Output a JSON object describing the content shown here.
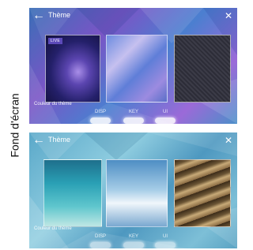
{
  "side_label": "Fond d'écran",
  "screens": [
    {
      "title": "Thème",
      "live_badge": "LIVE",
      "theme_color_label": "Couleur du thème",
      "tabs": [
        "DISP",
        "KEY",
        "UI"
      ]
    },
    {
      "title": "Thème",
      "theme_color_label": "Couleur du thème",
      "tabs": [
        "DISP",
        "KEY",
        "UI"
      ]
    }
  ],
  "icons": {
    "back": "arrow-left-icon",
    "close": "close-icon"
  },
  "colors": {
    "text": "#ffffff",
    "live_badge": "#5b49b8"
  }
}
